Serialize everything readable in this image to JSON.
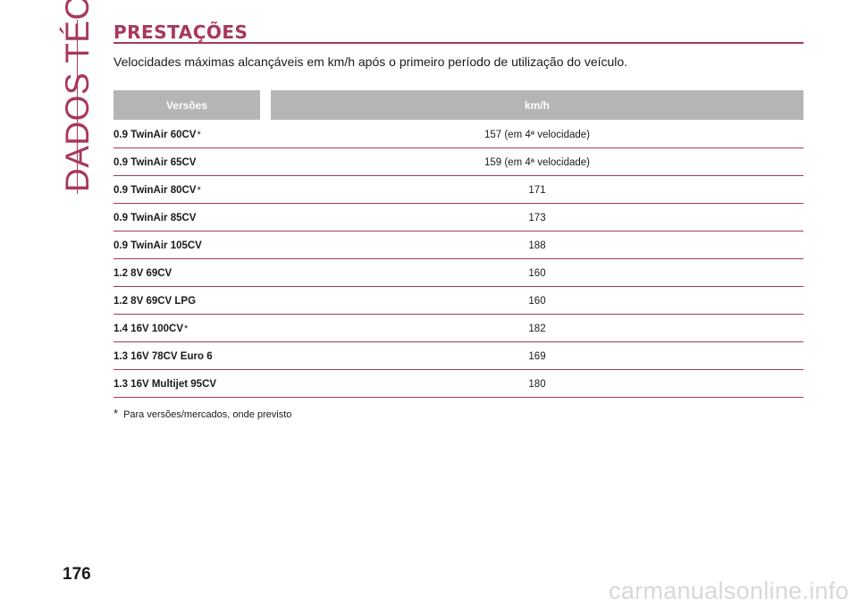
{
  "sidebar": {
    "section_label": "DADOS TÉCNICOS"
  },
  "page": {
    "number": "176"
  },
  "watermark": {
    "text": "carmanualsonline.info"
  },
  "section": {
    "title": "PRESTAÇÕES",
    "intro": "Velocidades máximas alcançáveis em km/h após o primeiro período de utilização do veículo."
  },
  "table": {
    "headers": {
      "versions": "Versões",
      "kmh": "km/h"
    },
    "rows": [
      {
        "version": "0.9 TwinAir 60CV",
        "mark": "*",
        "kmh": "157 (em 4ª velocidade)"
      },
      {
        "version": "0.9 TwinAir 65CV",
        "mark": "",
        "kmh": "159 (em 4ª velocidade)"
      },
      {
        "version": "0.9 TwinAir 80CV",
        "mark": "*",
        "kmh": "171"
      },
      {
        "version": "0.9 TwinAir 85CV",
        "mark": "",
        "kmh": "173"
      },
      {
        "version": "0.9 TwinAir 105CV",
        "mark": "",
        "kmh": "188"
      },
      {
        "version": "1.2 8V 69CV",
        "mark": "",
        "kmh": "160"
      },
      {
        "version": "1.2 8V 69CV LPG",
        "mark": "",
        "kmh": "160"
      },
      {
        "version": "1.4 16V 100CV",
        "mark": "*",
        "kmh": "182"
      },
      {
        "version": "1.3 16V 78CV Euro 6",
        "mark": "",
        "kmh": "169"
      },
      {
        "version": "1.3 16V Multijet 95CV",
        "mark": "",
        "kmh": "180"
      }
    ]
  },
  "footnote": {
    "mark": "*",
    "text": "Para versões/mercados, onde previsto"
  },
  "colors": {
    "accent": "#a8385a",
    "header_bg": "#b5b5b5"
  }
}
